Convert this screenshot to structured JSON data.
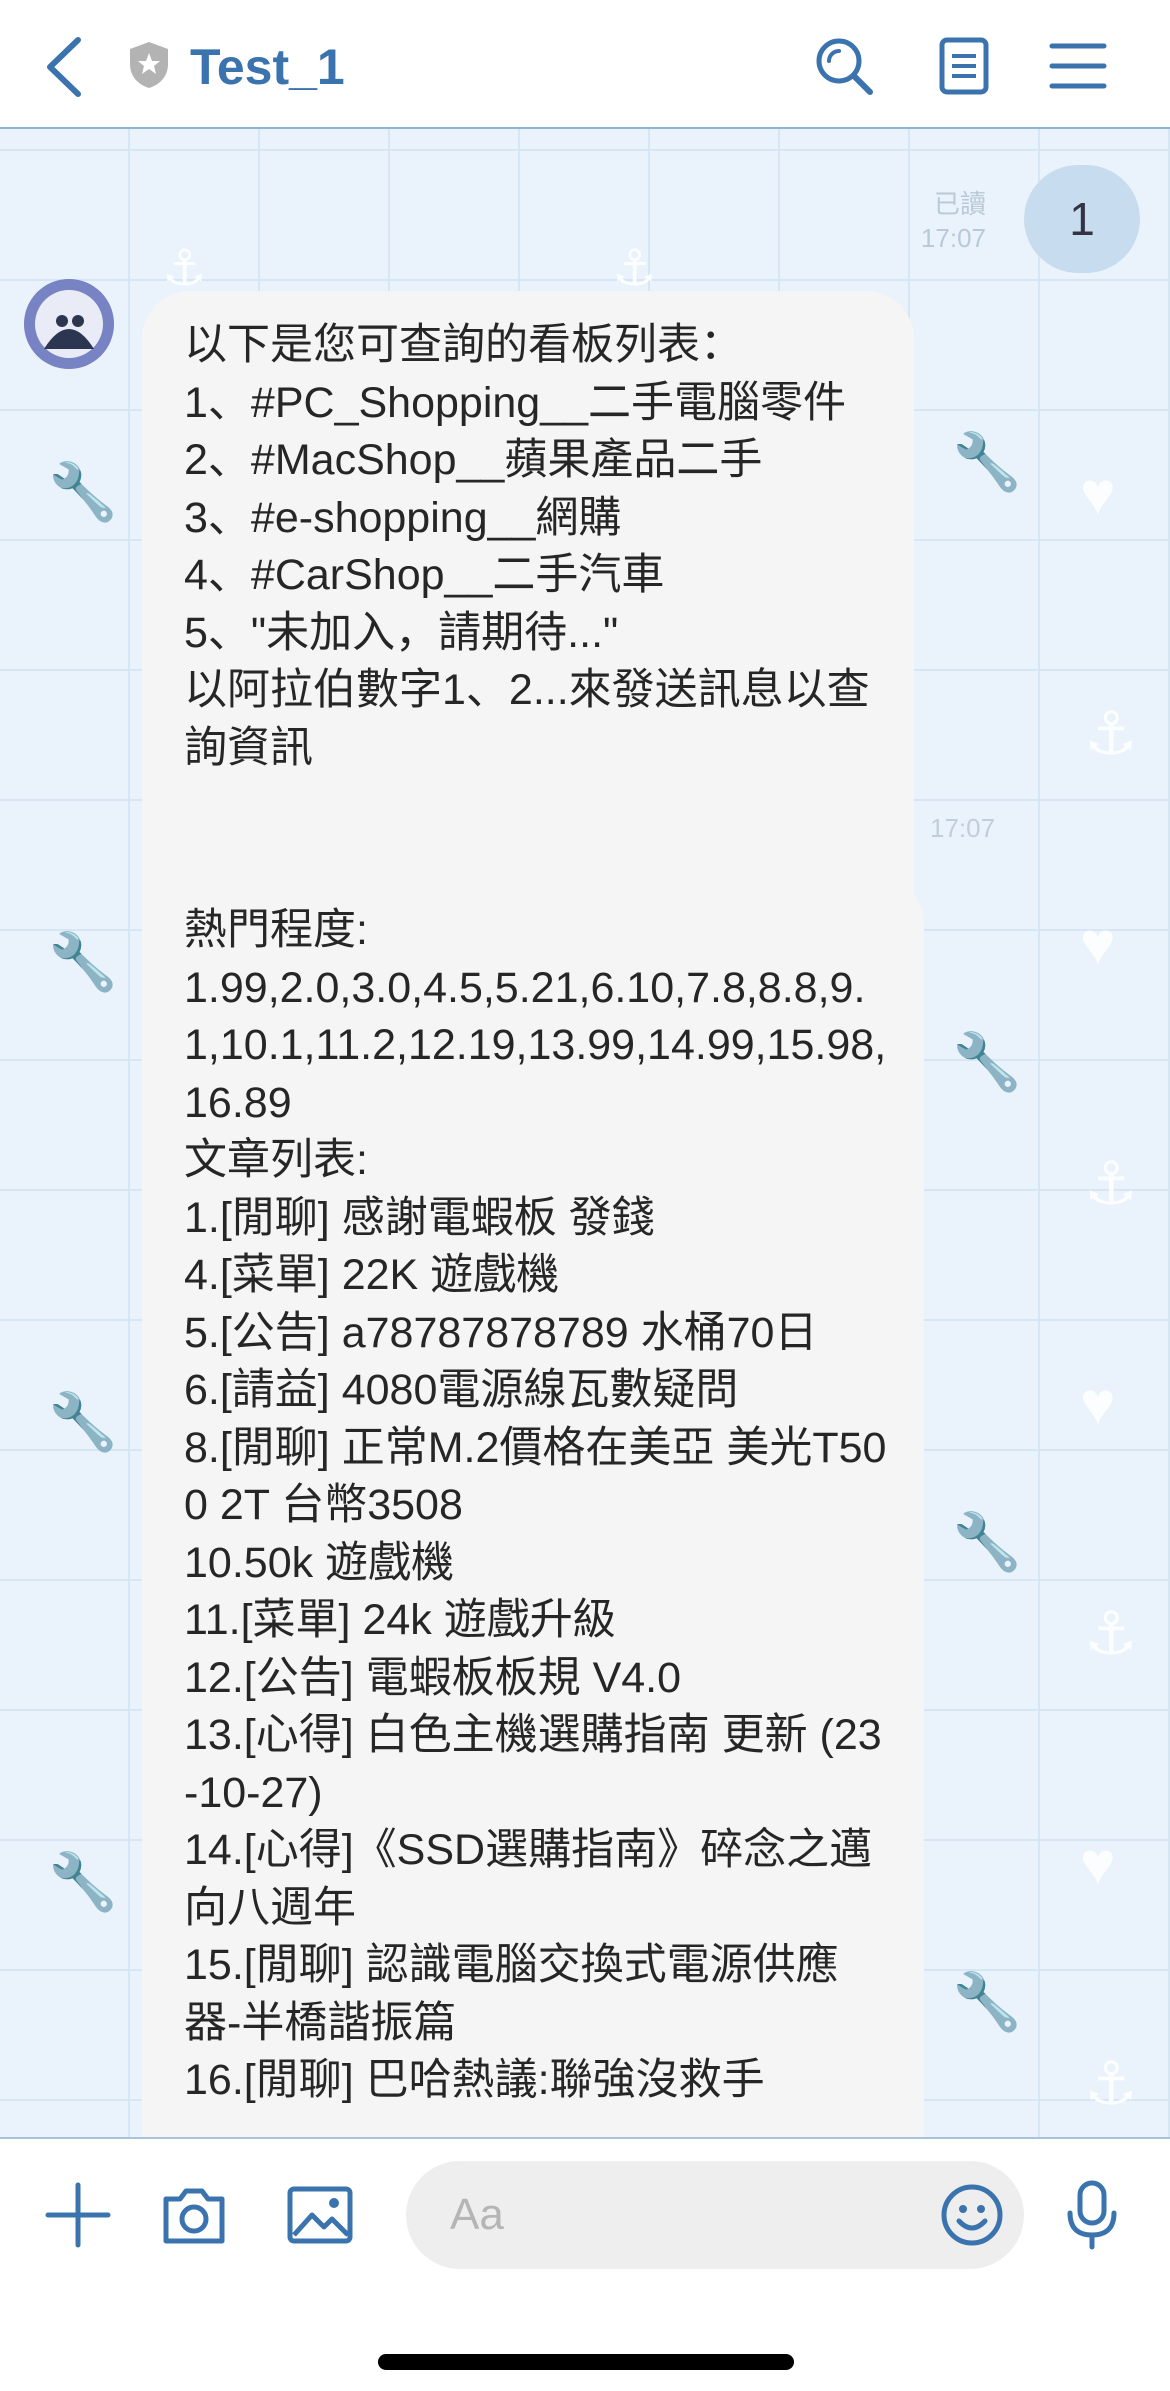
{
  "header": {
    "title": "Test_1",
    "icons": [
      "back-chevron-icon",
      "shield-icon",
      "search-icon",
      "notes-icon",
      "menu-icon"
    ]
  },
  "outgoing": {
    "text": "1",
    "status": "已讀",
    "time": "17:07"
  },
  "message1": {
    "lines": [
      "以下是您可查詢的看板列表：",
      "1、#PC_Shopping__二手電腦零件",
      "2、#MacShop__蘋果產品二手",
      "3、#e-shopping__網購",
      "4、#CarShop__二手汽車",
      "5、\"未加入，請期待...\"",
      "以阿拉伯數字1、2...來發送訊息以查詢資訊"
    ],
    "time": "17:07"
  },
  "message2": {
    "lines": [
      "熱門程度:",
      "1.99,2.0,3.0,4.5,5.21,6.10,7.8,8.8,9.1,10.1,11.2,12.19,13.99,14.99,15.98,16.89",
      "文章列表:",
      "1.[閒聊] 感謝電蝦板 發錢",
      "4.[菜單] 22K 遊戲機",
      "5.[公告] a78787878789 水桶70日",
      "6.[請益] 4080電源線瓦數疑問",
      "8.[閒聊] 正常M.2價格在美亞 美光T500 2T 台幣3508",
      "10.50k 遊戲機",
      "11.[菜單] 24k 遊戲升級",
      "12.[公告] 電蝦板板規 V4.0",
      "13.[心得] 白色主機選購指南 更新 (23-10-27)",
      "14.[心得]《SSD選購指南》碎念之邁向八週年",
      "15.[閒聊] 認識電腦交換式電源供應器-半橋諧振篇",
      "16.[閒聊] 巴哈熱議:聯強沒救手"
    ]
  },
  "input": {
    "placeholder": "Aa"
  },
  "colors": {
    "accent": "#3a73ad",
    "chat_background": "#eaf3fb",
    "bubble_incoming": "#f5f5f5",
    "bubble_outgoing": "#c7dcee"
  }
}
